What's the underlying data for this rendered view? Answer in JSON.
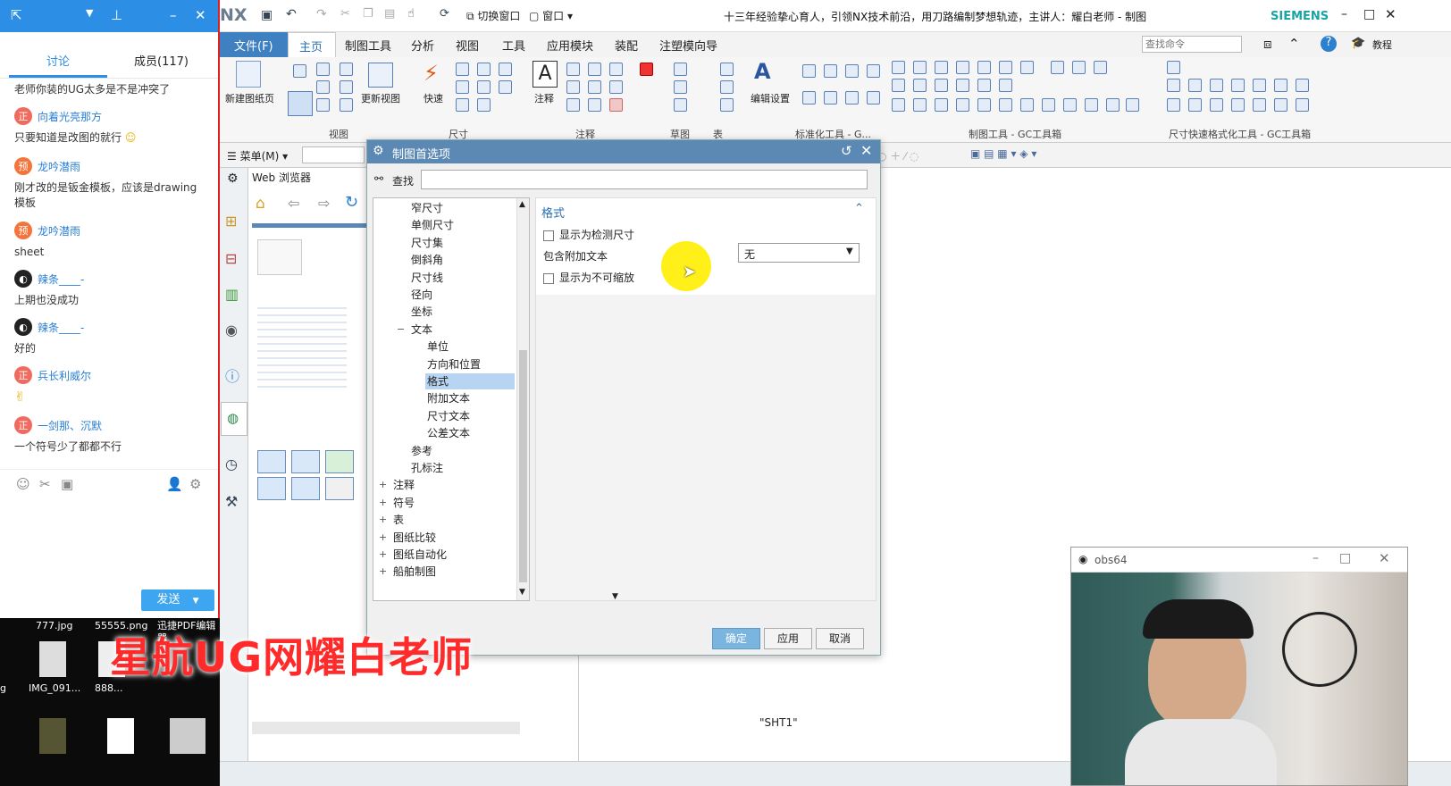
{
  "chat": {
    "tabs": [
      "讨论",
      "成员(117)"
    ],
    "messages": [
      {
        "user": "",
        "text": "老师你装的UG太多是不是冲突了"
      },
      {
        "user": "向着光亮那方",
        "avatar": "正",
        "text": "只要知道是改图的就行"
      },
      {
        "user": "龙吟潜雨",
        "avatar": "预",
        "text": "刚才改的是钣金模板，应该是drawing模板"
      },
      {
        "user": "龙吟潜雨",
        "avatar": "预",
        "text": "sheet"
      },
      {
        "user": "辣条____-",
        "avatar": "",
        "text": "上期也没成功"
      },
      {
        "user": "辣条____-",
        "avatar": "",
        "text": "好的"
      },
      {
        "user": "兵长利威尔",
        "avatar": "正",
        "text": ""
      },
      {
        "user": "一剑那、沉默",
        "avatar": "正",
        "text": "一个符号少了都都不行"
      }
    ],
    "send_label": "发送"
  },
  "desktop": {
    "files": [
      "777.jpg",
      "55555.png",
      "迅捷PDF编辑器",
      "IMG_091...",
      "888...",
      "g"
    ]
  },
  "nx": {
    "logo": "NX",
    "title": "十三年经验挚心育人，引领NX技术前沿，用刀路编制梦想轨迹，主讲人：耀白老师 - 制图",
    "brand": "SIEMENS",
    "switch_window": "切换窗口",
    "window_menu": "窗口",
    "menus": [
      "文件(F)",
      "主页",
      "制图工具",
      "分析",
      "视图",
      "工具",
      "应用模块",
      "装配",
      "注塑模向导"
    ],
    "search_placeholder": "查找命令",
    "tutorial": "教程",
    "ribbon": {
      "new_sheet": "新建图纸页",
      "update_view": "更新视图",
      "quick": "快速",
      "annotate": "注释",
      "edit_settings": "编辑设置",
      "groups": [
        "视图",
        "尺寸",
        "注释",
        "草图",
        "表",
        "标准化工具 - G...",
        "制图工具 - GC工具箱",
        "尺寸快速格式化工具 - GC工具箱"
      ]
    },
    "menu_button": "菜单(M)",
    "web_browser": "Web 浏览器",
    "sheet_label": "\"SHT1\""
  },
  "dialog": {
    "title": "制图首选项",
    "search_label": "查找",
    "tree": [
      {
        "label": "窄尺寸",
        "indent": 2
      },
      {
        "label": "单侧尺寸",
        "indent": 2
      },
      {
        "label": "尺寸集",
        "indent": 2
      },
      {
        "label": "倒斜角",
        "indent": 2
      },
      {
        "label": "尺寸线",
        "indent": 2
      },
      {
        "label": "径向",
        "indent": 2
      },
      {
        "label": "坐标",
        "indent": 2
      },
      {
        "label": "文本",
        "indent": 2,
        "expander": "−"
      },
      {
        "label": "单位",
        "indent": 3
      },
      {
        "label": "方向和位置",
        "indent": 3
      },
      {
        "label": "格式",
        "indent": 3,
        "selected": true
      },
      {
        "label": "附加文本",
        "indent": 3
      },
      {
        "label": "尺寸文本",
        "indent": 3
      },
      {
        "label": "公差文本",
        "indent": 3
      },
      {
        "label": "参考",
        "indent": 2
      },
      {
        "label": "孔标注",
        "indent": 2
      },
      {
        "label": "注释",
        "indent": 1,
        "expander": "+"
      },
      {
        "label": "符号",
        "indent": 1,
        "expander": "+"
      },
      {
        "label": "表",
        "indent": 1,
        "expander": "+"
      },
      {
        "label": "图纸比较",
        "indent": 1,
        "expander": "+"
      },
      {
        "label": "图纸自动化",
        "indent": 1,
        "expander": "+"
      },
      {
        "label": "船舶制图",
        "indent": 1,
        "expander": "+"
      }
    ],
    "section_title": "格式",
    "opt_inspect": "显示为检测尺寸",
    "opt_append_label": "包含附加文本",
    "opt_append_value": "无",
    "opt_nonscale": "显示为不可缩放",
    "ok": "确定",
    "apply": "应用",
    "cancel": "取消"
  },
  "webcam": {
    "title": "obs64"
  },
  "watermark": "星航UG网耀白老师"
}
